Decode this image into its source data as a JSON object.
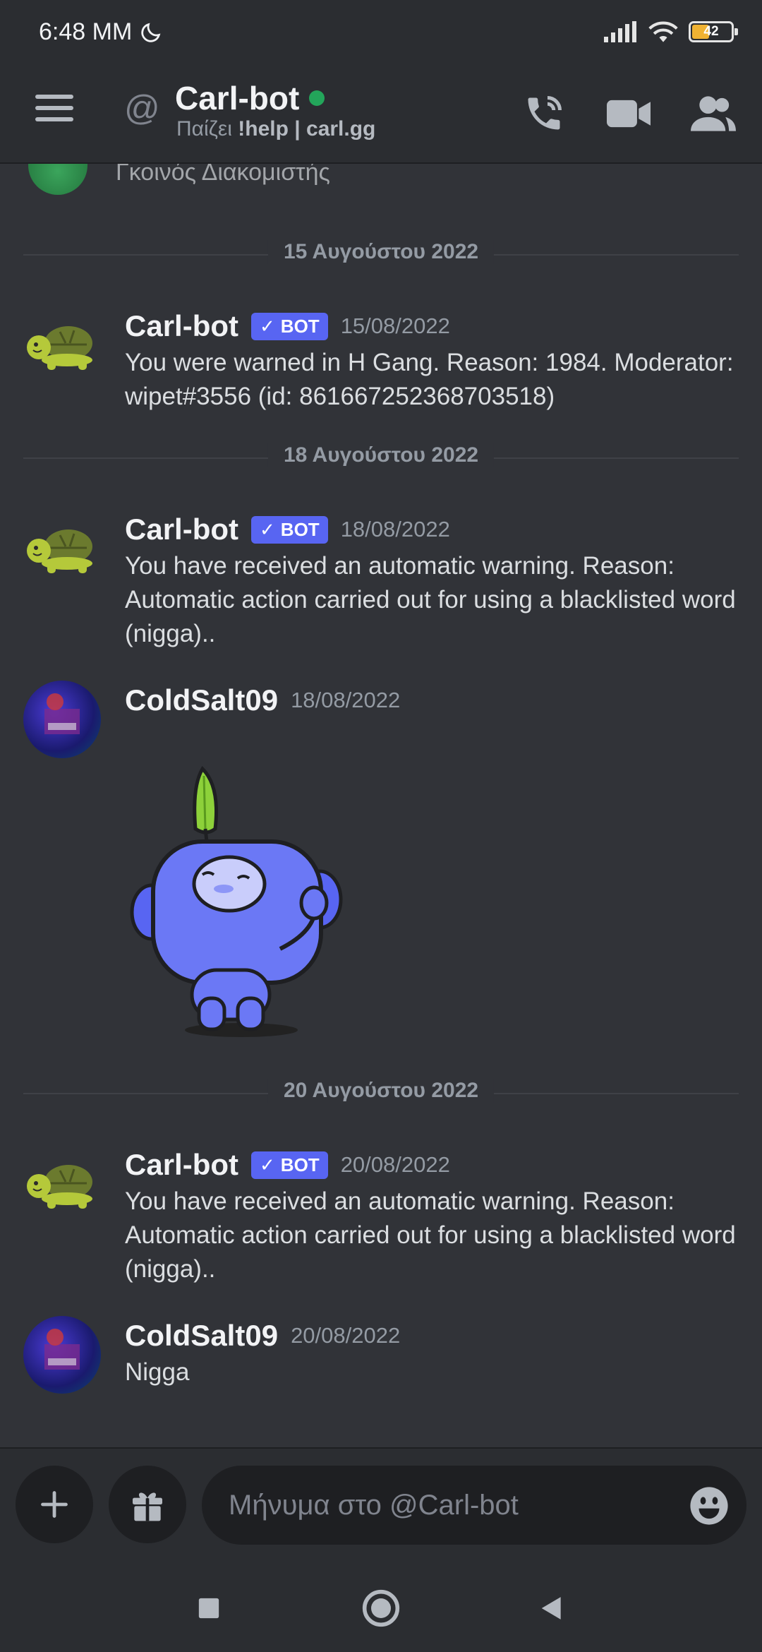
{
  "status_bar": {
    "time": "6:48 MM",
    "battery": "42"
  },
  "header": {
    "title": "Carl-bot",
    "subtitle_prefix": "Παίζει ",
    "subtitle_bold": "!help | carl.gg"
  },
  "partial_message": {
    "text": "Γκοινός Διακομιστής"
  },
  "dividers": [
    "15 Αυγούστου 2022",
    "18 Αυγούστου 2022",
    "20 Αυγούστου 2022"
  ],
  "messages": [
    {
      "user": "Carl-bot",
      "badge": "BOT",
      "timestamp": "15/08/2022",
      "text": "You were warned in H Gang. Reason: 1984. Moderator: wipet#3556 (id: 861667252368703518)"
    },
    {
      "user": "Carl-bot",
      "badge": "BOT",
      "timestamp": "18/08/2022",
      "text": "You have received an automatic warning. Reason: Automatic action carried out for using a blacklisted word (nigga).."
    },
    {
      "user": "ColdSalt09",
      "timestamp": "18/08/2022",
      "sticker": "wumpus-leaf-sticker"
    },
    {
      "user": "Carl-bot",
      "badge": "BOT",
      "timestamp": "20/08/2022",
      "text": "You have received an automatic warning. Reason: Automatic action carried out for using a blacklisted word (nigga).."
    },
    {
      "user": "ColdSalt09",
      "timestamp": "20/08/2022",
      "text": "Nigga"
    }
  ],
  "input": {
    "placeholder": "Μήνυμα στο @Carl-bot"
  },
  "colors": {
    "accent": "#5865f2",
    "online": "#23a55a",
    "background": "#313338"
  }
}
